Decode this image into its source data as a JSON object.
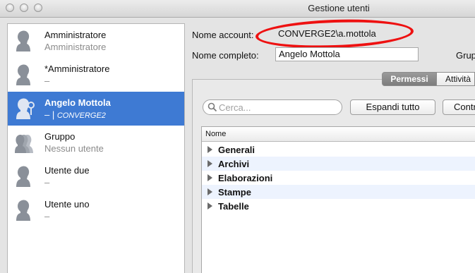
{
  "window": {
    "title": "Gestione utenti"
  },
  "users": [
    {
      "name": "Amministratore",
      "subtitle": "Amministratore",
      "icon": "user-icon"
    },
    {
      "name": "*Amministratore",
      "subtitle": "–",
      "icon": "user-icon"
    },
    {
      "name": "Angelo Mottola",
      "subtitle_prefix": "– |",
      "subtitle_domain": "CONVERGE2",
      "icon": "user-admin-icon",
      "selected": true
    },
    {
      "name": "Gruppo",
      "subtitle": "Nessun utente",
      "icon": "group-icon"
    },
    {
      "name": "Utente due",
      "subtitle": "–",
      "icon": "user-icon"
    },
    {
      "name": "Utente uno",
      "subtitle": "–",
      "icon": "user-icon"
    }
  ],
  "form": {
    "account_label": "Nome account:",
    "account_value": "CONVERGE2\\a.mottola",
    "fullname_label": "Nome completo:",
    "fullname_value": "Angelo Mottola",
    "group_label": "Grup"
  },
  "tabs": [
    {
      "label": "Permessi",
      "active": true
    },
    {
      "label": "Attività",
      "active": false
    }
  ],
  "toolbar": {
    "search_placeholder": "Cerca...",
    "expand_all": "Espandi tutto",
    "collapse_all": "Contr"
  },
  "tree": {
    "header": "Nome",
    "rows": [
      "Generali",
      "Archivi",
      "Elaborazioni",
      "Stampe",
      "Tabelle"
    ]
  },
  "colors": {
    "selection": "#3e7ad3",
    "annotation": "#ee1111",
    "alt_row": "#edf3fe"
  }
}
